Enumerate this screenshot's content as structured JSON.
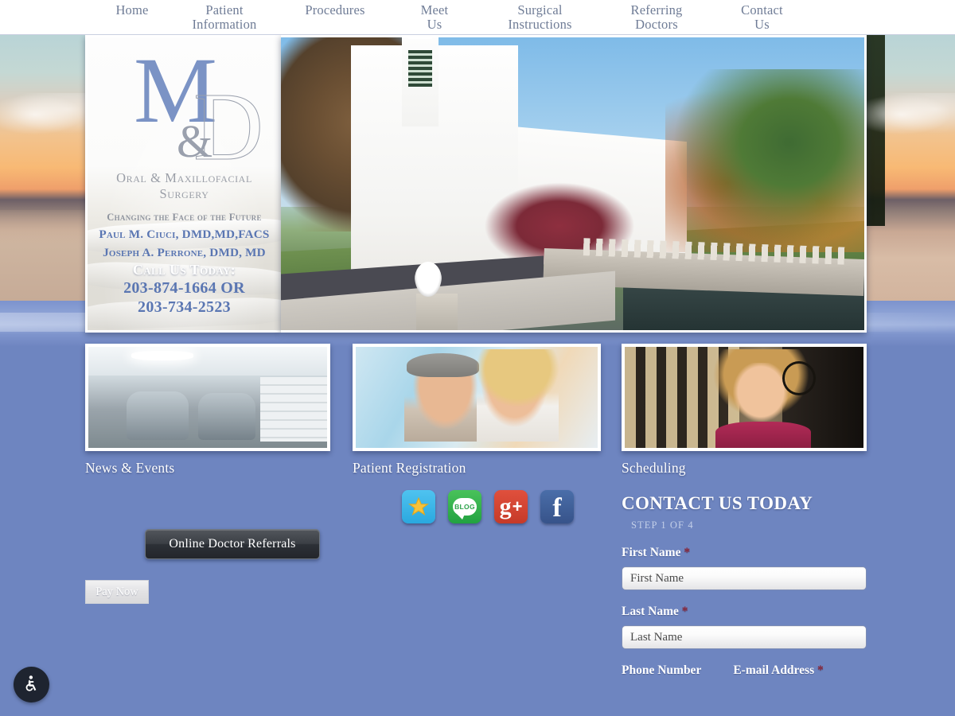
{
  "nav": {
    "items": [
      {
        "label": "Home",
        "name": "nav-home"
      },
      {
        "label": "Patient\nInformation",
        "name": "nav-patient-information"
      },
      {
        "label": "Procedures",
        "name": "nav-procedures"
      },
      {
        "label": "Meet\nUs",
        "name": "nav-meet-us"
      },
      {
        "label": "Surgical\nInstructions",
        "name": "nav-surgical-instructions"
      },
      {
        "label": "Referring\nDoctors",
        "name": "nav-referring-doctors"
      },
      {
        "label": "Contact\nUs",
        "name": "nav-contact-us"
      }
    ]
  },
  "logo": {
    "letter_m": "M",
    "letter_d": "D",
    "ampersand": "&",
    "specialty_line1": "Oral & Maxillofacial",
    "specialty_line2": "Surgery",
    "tagline": "Changing the Face of the Future",
    "doctor_1": "Paul M. Ciuci, DMD,MD,FACS",
    "doctor_2": "Joseph A. Perrone, DMD, MD",
    "call_label": "Call Us Today:",
    "phone_1": "203-874-1664 OR",
    "phone_2": "203-734-2523"
  },
  "hero": {
    "image_alt": "new-england-church-autumn-bridge-photo"
  },
  "cards": [
    {
      "label": "News & Events",
      "name": "card-news-events",
      "image_alt": "dental-operatory-photo"
    },
    {
      "label": "Patient Registration",
      "name": "card-patient-registration",
      "image_alt": "smiling-mature-couple-photo"
    },
    {
      "label": "Scheduling",
      "name": "card-scheduling",
      "image_alt": "headset-receptionist-photo"
    }
  ],
  "socials": [
    {
      "name": "review-star-icon",
      "label": "",
      "title": "Reviews"
    },
    {
      "name": "blog-icon",
      "label": "BLOG",
      "title": "Blog"
    },
    {
      "name": "google-plus-icon",
      "label": "g",
      "title": "Google Plus"
    },
    {
      "name": "facebook-icon",
      "label": "f",
      "title": "Facebook"
    }
  ],
  "buttons": {
    "referrals": "Online Doctor Referrals",
    "pay_now": "Pay Now"
  },
  "contact": {
    "heading": "CONTACT US TODAY",
    "step": "STEP 1 OF 4",
    "first_name_label": "First Name",
    "first_name_placeholder": "First Name",
    "first_name_value": "",
    "last_name_label": "Last Name",
    "last_name_placeholder": "Last Name",
    "last_name_value": "",
    "phone_label": "Phone Number",
    "email_label": "E-mail Address",
    "required_marker": "*"
  },
  "accessibility": {
    "name": "accessibility-wheelchair-icon",
    "title": "Accessibility Options"
  },
  "colors": {
    "page_background": "#6e85c0",
    "nav_background": "#ffffff",
    "nav_text": "#6f7c96",
    "logo_blue": "#5a76b2",
    "required_red": "#8c2436",
    "button_dark": "#2c3036"
  }
}
